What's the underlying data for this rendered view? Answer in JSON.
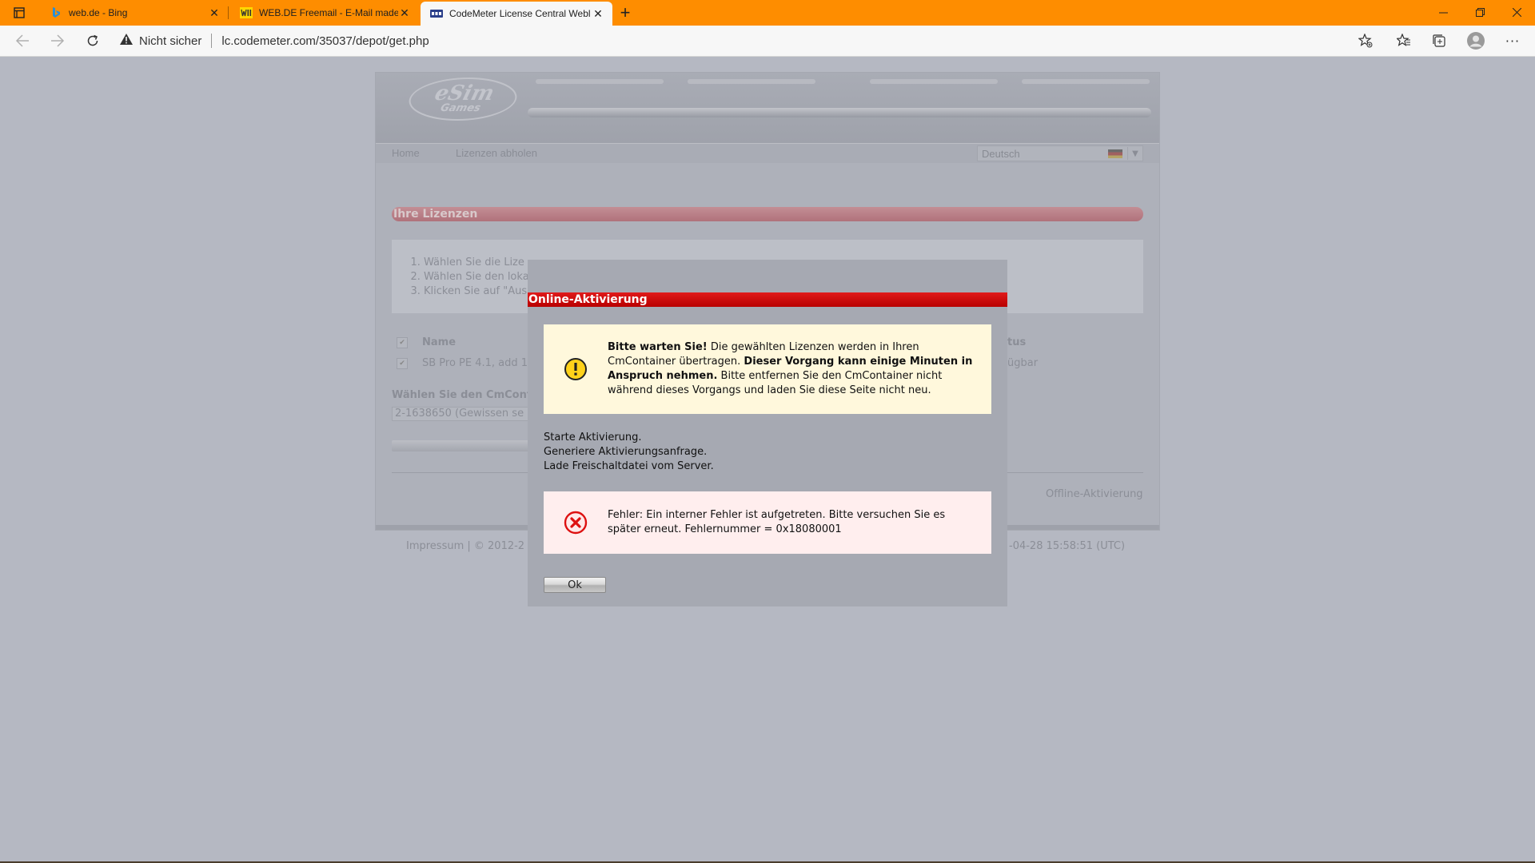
{
  "browser": {
    "tabs": [
      {
        "title": "web.de - Bing",
        "active": false
      },
      {
        "title": "WEB.DE Freemail - E-Mail made",
        "active": false
      },
      {
        "title": "CodeMeter License Central Webl",
        "active": true
      }
    ],
    "security_label": "Nicht sicher",
    "url": "lc.codemeter.com/35037/depot/get.php",
    "tab_color": "#fe8d00"
  },
  "site": {
    "logo_line1": "eSim",
    "logo_line2": "Games",
    "nav": {
      "home": "Home",
      "get_licenses": "Lizenzen abholen"
    },
    "language": "Deutsch",
    "section_title": "Ihre Lizenzen",
    "instructions": [
      "Wählen Sie die Lize",
      "Wählen Sie den loka",
      "Klicken Sie auf \"Aus"
    ],
    "table": {
      "col_name": "Name",
      "col_status": "tus",
      "row_name": "SB Pro PE 4.1, add 1",
      "row_status": "ügbar"
    },
    "container_label": "Wählen Sie den CmCont",
    "container_value": "2-1638650 (Gewissen se",
    "offline_link": "Offline-Aktivierung",
    "footer_left": "Impressum | © 2012-2",
    "footer_right": "-04-28 15:58:51 (UTC)"
  },
  "modal": {
    "title": "Online-Aktivierung",
    "title_color": "#d00000",
    "warning": {
      "icon": "warning-icon",
      "bold1": "Bitte warten Sie!",
      "text1": " Die gewählten Lizenzen werden in Ihren CmContainer übertragen. ",
      "bold2": "Dieser Vorgang kann einige Minuten in Anspruch nehmen.",
      "text2": " Bitte entfernen Sie den CmContainer nicht während dieses Vorgangs und laden Sie diese Seite nicht neu."
    },
    "status_lines": [
      "Starte Aktivierung.",
      "Generiere Aktivierungsanfrage.",
      "Lade Freischaltdatei vom Server."
    ],
    "error": {
      "icon": "error-icon",
      "text": "Fehler: Ein interner Fehler ist aufgetreten. Bitte versuchen Sie es später erneut. Fehlernummer = 0x18080001"
    },
    "ok_label": "Ok"
  }
}
